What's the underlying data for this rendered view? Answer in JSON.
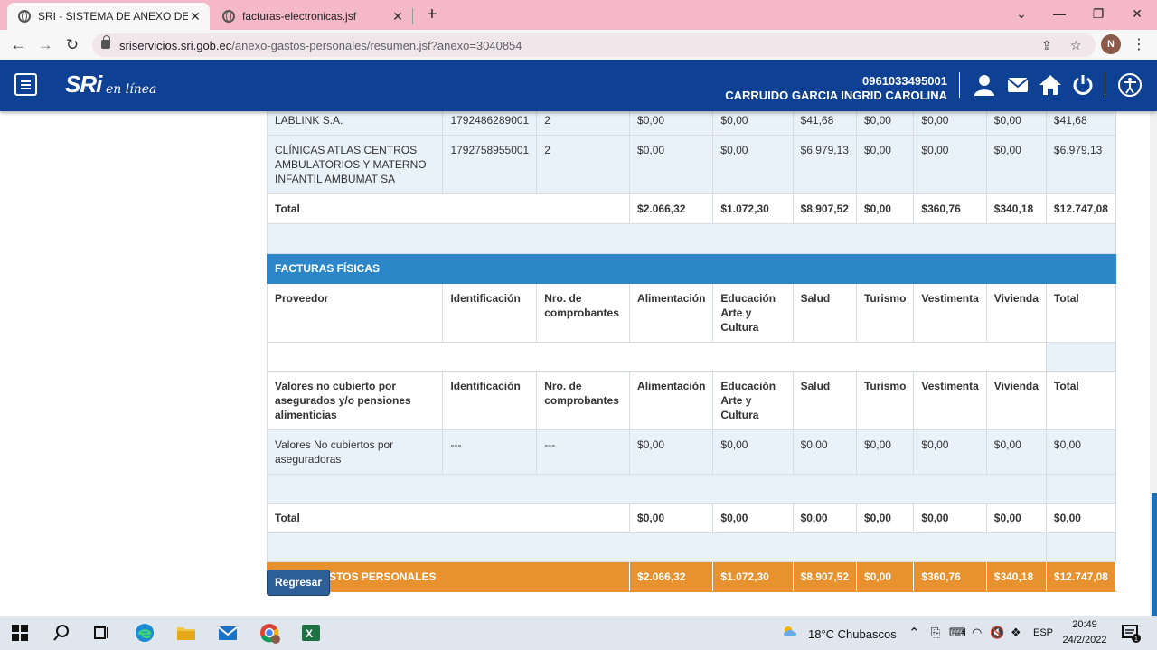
{
  "browser": {
    "tabs": [
      {
        "title": "SRI - SISTEMA DE ANEXO DE GASTOS",
        "active": true
      },
      {
        "title": "facturas-electronicas.jsf",
        "active": false
      }
    ],
    "url_host": "sriservicios.sri.gob.ec",
    "url_path": "/anexo-gastos-personales/resumen.jsf?anexo=3040854",
    "profile_initial": "N"
  },
  "header": {
    "logo_text": "SRi",
    "logo_sub": "en línea",
    "user_id": "0961033495001",
    "user_name": "CARRUIDO GARCIA INGRID CAROLINA"
  },
  "electronic_rows": [
    {
      "proveedor": "LABLINK S.A.",
      "id": "1792486289001",
      "nro": "2",
      "alimentacion": "$0,00",
      "educacion": "$0,00",
      "salud": "$41,68",
      "turismo": "$0,00",
      "vestimenta": "$0,00",
      "vivienda": "$0,00",
      "total": "$41,68"
    },
    {
      "proveedor": "CLÍNICAS ATLAS CENTROS AMBULATORIOS Y MATERNO INFANTIL AMBUMAT SA",
      "id": "1792758955001",
      "nro": "2",
      "alimentacion": "$0,00",
      "educacion": "$0,00",
      "salud": "$6.979,13",
      "turismo": "$0,00",
      "vestimenta": "$0,00",
      "vivienda": "$0,00",
      "total": "$6.979,13"
    }
  ],
  "electronic_total": {
    "label": "Total",
    "alimentacion": "$2.066,32",
    "educacion": "$1.072,30",
    "salud": "$8.907,52",
    "turismo": "$0,00",
    "vestimenta": "$360,76",
    "vivienda": "$340,18",
    "total": "$12.747,08"
  },
  "physical": {
    "section_title": "FACTURAS FÍSICAS",
    "headers": {
      "proveedor": "Proveedor",
      "id": "Identificación",
      "nro": "Nro. de comprobantes",
      "alimentacion": "Alimentación",
      "educacion": "Educación Arte y Cultura",
      "salud": "Salud",
      "turismo": "Turismo",
      "vestimenta": "Vestimenta",
      "vivienda": "Vivienda",
      "total": "Total"
    }
  },
  "uncovered": {
    "headers": {
      "proveedor": "Valores no cubierto por asegurados y/o pensiones alimenticias",
      "id": "Identificación",
      "nro": "Nro. de comprobantes",
      "alimentacion": "Alimentación",
      "educacion": "Educación Arte y Cultura",
      "salud": "Salud",
      "turismo": "Turismo",
      "vestimenta": "Vestimenta",
      "vivienda": "Vivienda",
      "total": "Total"
    },
    "row": {
      "proveedor": "Valores No cubiertos por aseguradoras",
      "id": "---",
      "nro": "---",
      "alimentacion": "$0,00",
      "educacion": "$0,00",
      "salud": "$0,00",
      "turismo": "$0,00",
      "vestimenta": "$0,00",
      "vivienda": "$0,00",
      "total": "$0,00"
    },
    "total": {
      "label": "Total",
      "alimentacion": "$0,00",
      "educacion": "$0,00",
      "salud": "$0,00",
      "turismo": "$0,00",
      "vestimenta": "$0,00",
      "vivienda": "$0,00",
      "total": "$0,00"
    }
  },
  "grand_total": {
    "label": "TOTAL GASTOS PERSONALES",
    "alimentacion": "$2.066,32",
    "educacion": "$1.072,30",
    "salud": "$8.907,52",
    "turismo": "$0,00",
    "vestimenta": "$360,76",
    "vivienda": "$340,18",
    "total": "$12.747,08"
  },
  "back_button": "Regresar",
  "taskbar": {
    "weather": "18°C  Chubascos",
    "lang": "ESP",
    "time": "20:49",
    "date": "24/2/2022",
    "notifications": "1"
  },
  "colors": {
    "header_blue": "#0e4194",
    "section_blue": "#2d86c8",
    "total_orange": "#e7912f",
    "tab_pink": "#f4b8c8"
  }
}
